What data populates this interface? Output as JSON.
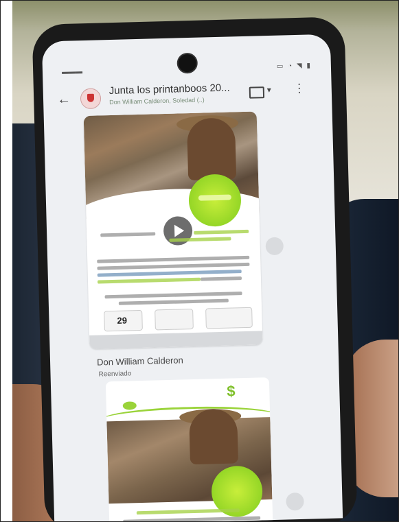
{
  "chat": {
    "title": "Junta los printanboos 20...",
    "subtitle": "Don William Calderon, Soledad (..)"
  },
  "calendar": {
    "day": "29"
  },
  "second_message": {
    "sender": "Don William Calderon",
    "forwarded": "Reenviado"
  },
  "colors": {
    "accent_green": "#9ad33a",
    "chat_bg": "#eef0f3"
  },
  "icons": [
    "back-arrow-icon",
    "video-call-icon",
    "more-menu-icon",
    "play-icon",
    "forward-icon",
    "dollar-icon",
    "leaf-icon"
  ]
}
